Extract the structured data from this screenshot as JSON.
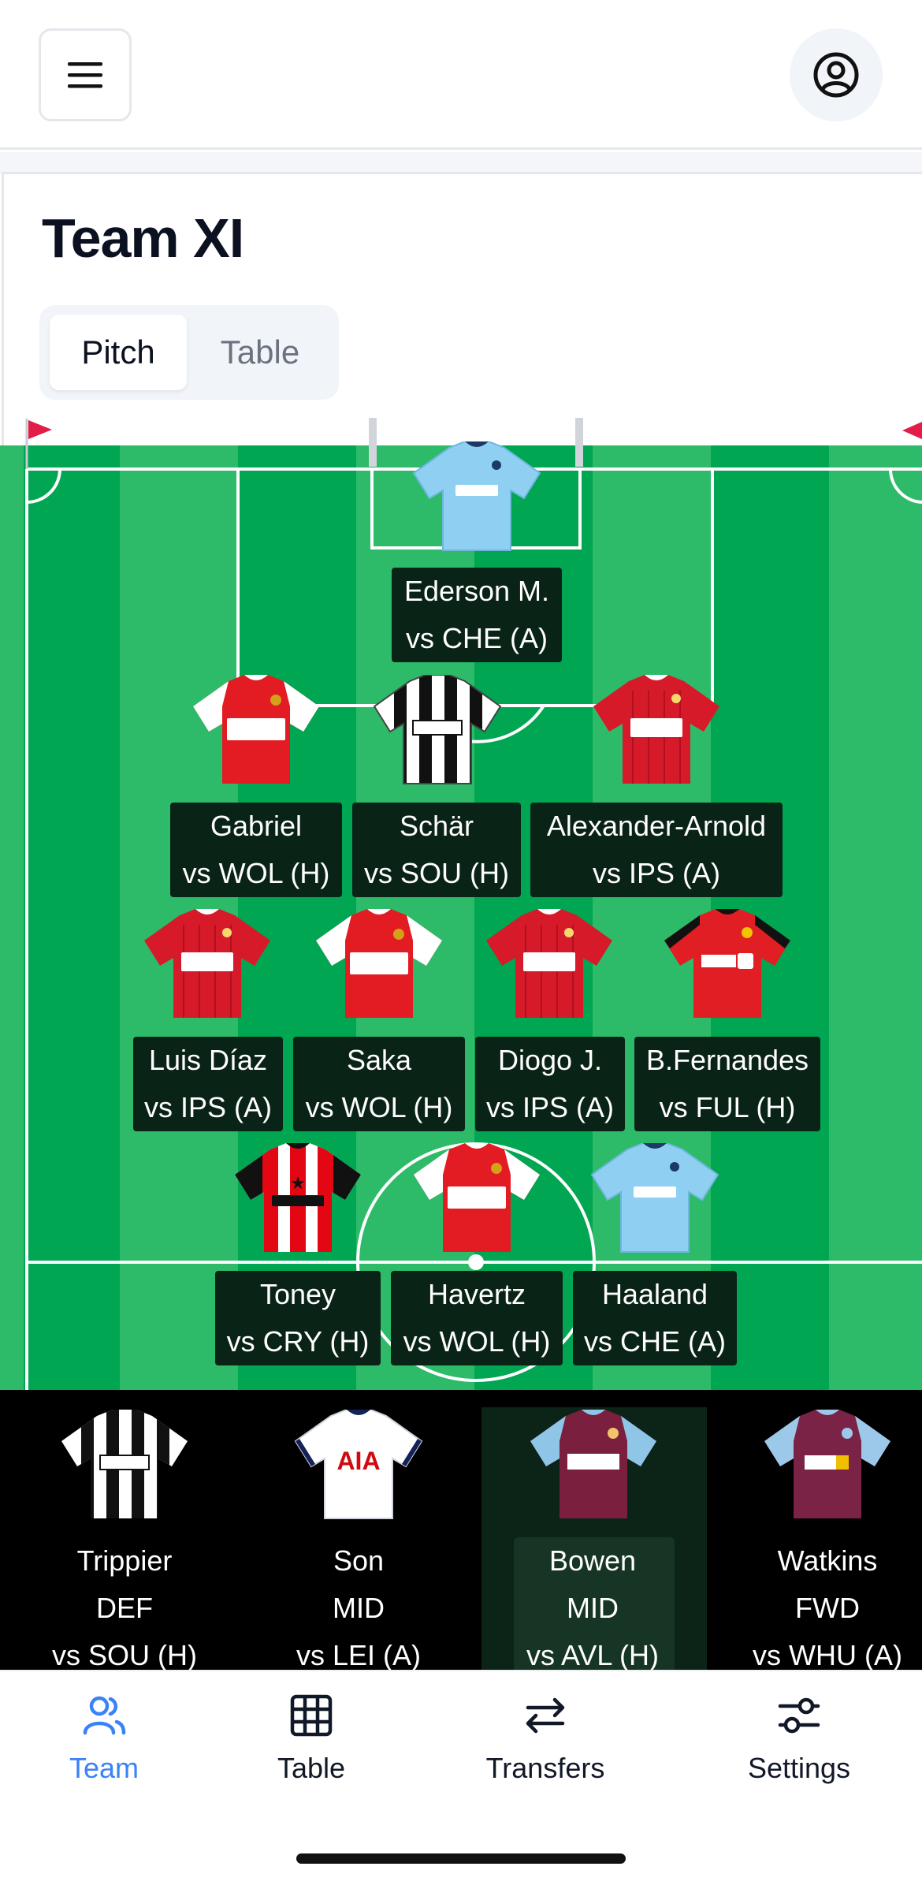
{
  "header": {
    "menu_icon": "hamburger-menu-icon",
    "account_icon": "user-circle-icon"
  },
  "page": {
    "title": "Team XI",
    "view_toggle": {
      "options": [
        "Pitch",
        "Table"
      ],
      "selected": "Pitch"
    }
  },
  "pitch": {
    "goalkeeper": [
      {
        "name": "Ederson M.",
        "fixture": "vs CHE (A)",
        "kit": "city"
      }
    ],
    "defenders": [
      {
        "name": "Gabriel",
        "fixture": "vs WOL (H)",
        "kit": "arsenal"
      },
      {
        "name": "Schär",
        "fixture": "vs SOU (H)",
        "kit": "newcastle"
      },
      {
        "name": "Alexander-Arnold",
        "fixture": "vs IPS (A)",
        "kit": "liverpool"
      }
    ],
    "midfielders": [
      {
        "name": "Luis Díaz",
        "fixture": "vs IPS (A)",
        "kit": "liverpool"
      },
      {
        "name": "Saka",
        "fixture": "vs WOL (H)",
        "kit": "arsenal"
      },
      {
        "name": "Diogo J.",
        "fixture": "vs IPS (A)",
        "kit": "liverpool"
      },
      {
        "name": "B.Fernandes",
        "fixture": "vs FUL (H)",
        "kit": "united"
      }
    ],
    "forwards": [
      {
        "name": "Toney",
        "fixture": "vs CRY (H)",
        "kit": "brentford"
      },
      {
        "name": "Havertz",
        "fixture": "vs WOL (H)",
        "kit": "arsenal"
      },
      {
        "name": "Haaland",
        "fixture": "vs CHE (A)",
        "kit": "city"
      }
    ]
  },
  "bench": [
    {
      "name": "Trippier",
      "position": "DEF",
      "fixture": "vs SOU (H)",
      "kit": "newcastle"
    },
    {
      "name": "Son",
      "position": "MID",
      "fixture": "vs LEI (A)",
      "kit": "spurs",
      "sponsor": "AIA"
    },
    {
      "name": "Bowen",
      "position": "MID",
      "fixture": "vs AVL (H)",
      "kit": "westham",
      "selected": true
    },
    {
      "name": "Watkins",
      "position": "FWD",
      "fixture": "vs WHU (A)",
      "kit": "villa"
    }
  ],
  "bottom_nav": {
    "items": [
      {
        "label": "Team",
        "icon": "users-icon",
        "active": true
      },
      {
        "label": "Table",
        "icon": "table-grid-icon",
        "active": false
      },
      {
        "label": "Transfers",
        "icon": "arrows-swap-icon",
        "active": false
      },
      {
        "label": "Settings",
        "icon": "sliders-icon",
        "active": false
      }
    ]
  },
  "colors": {
    "pitch_dark": "#00a651",
    "pitch_light": "#2dbb6a",
    "label_bg": "#0a2317",
    "active_nav": "#3b82f6",
    "arsenal_red": "#e31b23",
    "liverpool_red": "#d61a2a",
    "city_blue": "#8fd0f2",
    "westham_claret": "#7a1f3d",
    "villa_claret": "#7b2346"
  }
}
